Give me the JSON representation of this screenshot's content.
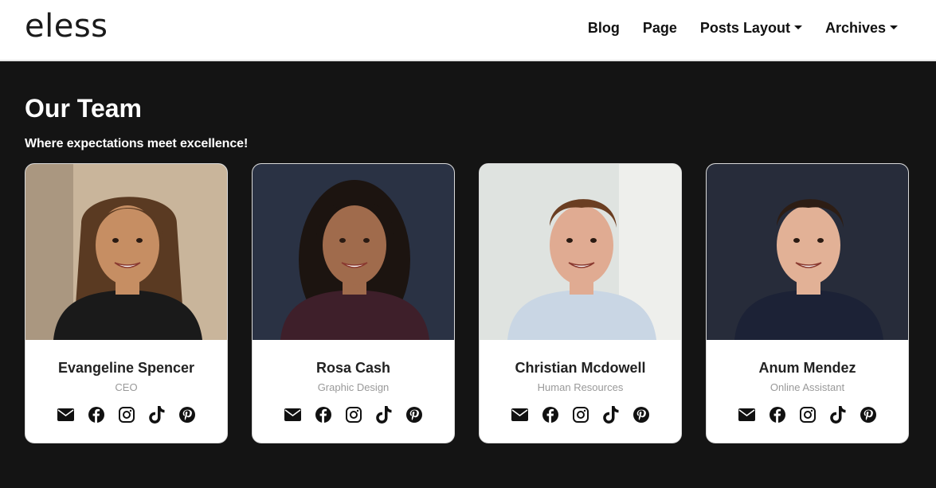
{
  "brand": {
    "logo_text": "eless"
  },
  "nav": {
    "items": [
      {
        "label": "Blog",
        "dropdown": false
      },
      {
        "label": "Page",
        "dropdown": false
      },
      {
        "label": "Posts Layout",
        "dropdown": true
      },
      {
        "label": "Archives",
        "dropdown": true
      }
    ]
  },
  "section": {
    "title": "Our Team",
    "subtitle": "Where expectations meet excellence!"
  },
  "team": [
    {
      "name": "Evangeline Spencer",
      "role": "CEO",
      "photo_bg": "#c9b59b",
      "skin": "#c68e63",
      "hair": "#5a3a22",
      "shirt": "#1a1a1a"
    },
    {
      "name": "Rosa Cash",
      "role": "Graphic Design",
      "photo_bg": "#2a3244",
      "skin": "#a06b4c",
      "hair": "#1c1410",
      "shirt": "#3e1f2a"
    },
    {
      "name": "Christian Mcdowell",
      "role": "Human Resources",
      "photo_bg": "#dfe3e0",
      "skin": "#e0ab92",
      "hair": "#6b3e22",
      "shirt": "#c9d6e4"
    },
    {
      "name": "Anum Mendez",
      "role": "Online Assistant",
      "photo_bg": "#272c3a",
      "skin": "#e2b196",
      "hair": "#2d1d14",
      "shirt": "#1c2236"
    }
  ],
  "social_icons": [
    "envelope-icon",
    "facebook-icon",
    "instagram-icon",
    "tiktok-icon",
    "pinterest-icon"
  ],
  "colors": {
    "page_bg": "#141414",
    "navbar_bg": "#ffffff",
    "card_bg": "#ffffff",
    "role_text": "#999999"
  }
}
